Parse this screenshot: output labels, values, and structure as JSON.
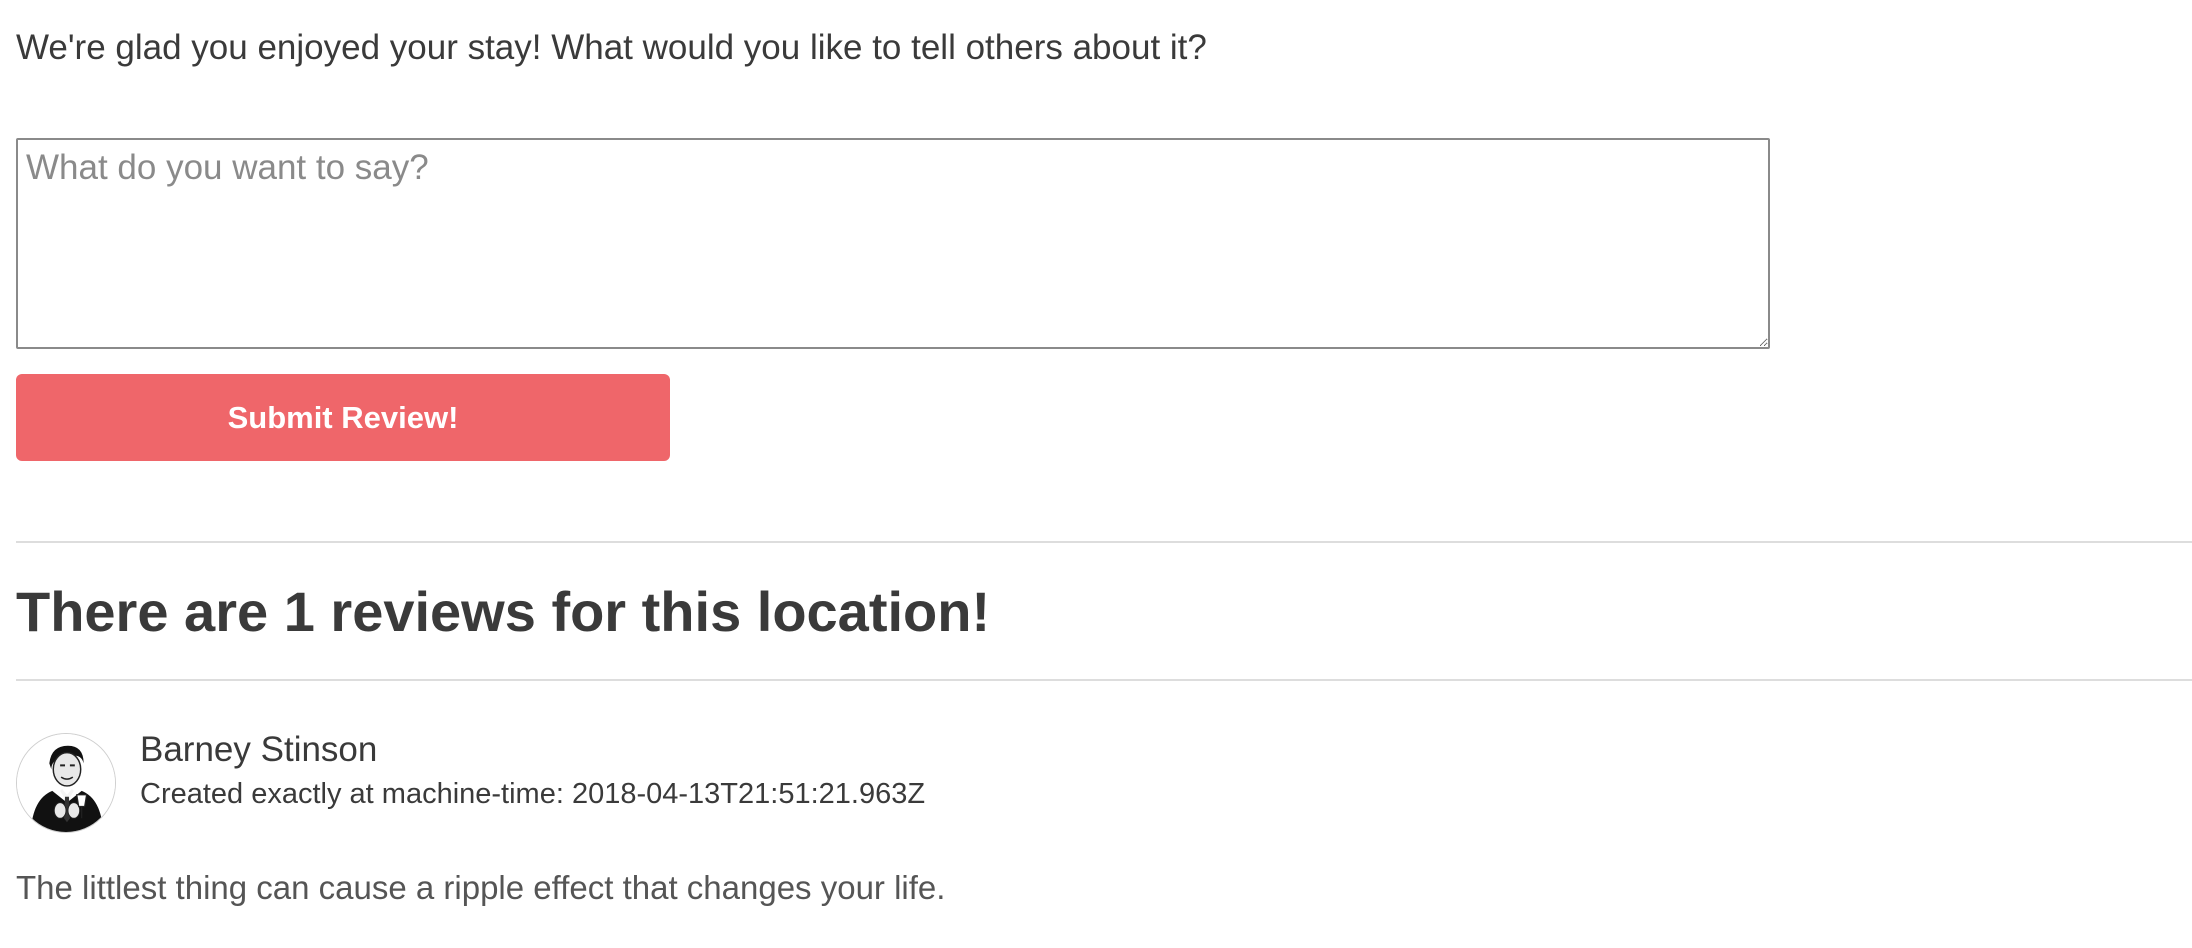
{
  "review_form": {
    "prompt": "We're glad you enjoyed your stay! What would you like to tell others about it?",
    "textarea_value": "",
    "textarea_placeholder": "What do you want to say?",
    "submit_label": "Submit Review!",
    "submit_color": "#ef666a"
  },
  "reviews_section": {
    "heading": "There are 1 reviews for this location!",
    "reviews": [
      {
        "avatar_icon": "user-avatar",
        "author": "Barney Stinson",
        "created_text": "Created exactly at machine-time: 2018-04-13T21:51:21.963Z",
        "body": "The littlest thing can cause a ripple effect that changes your life."
      }
    ]
  }
}
